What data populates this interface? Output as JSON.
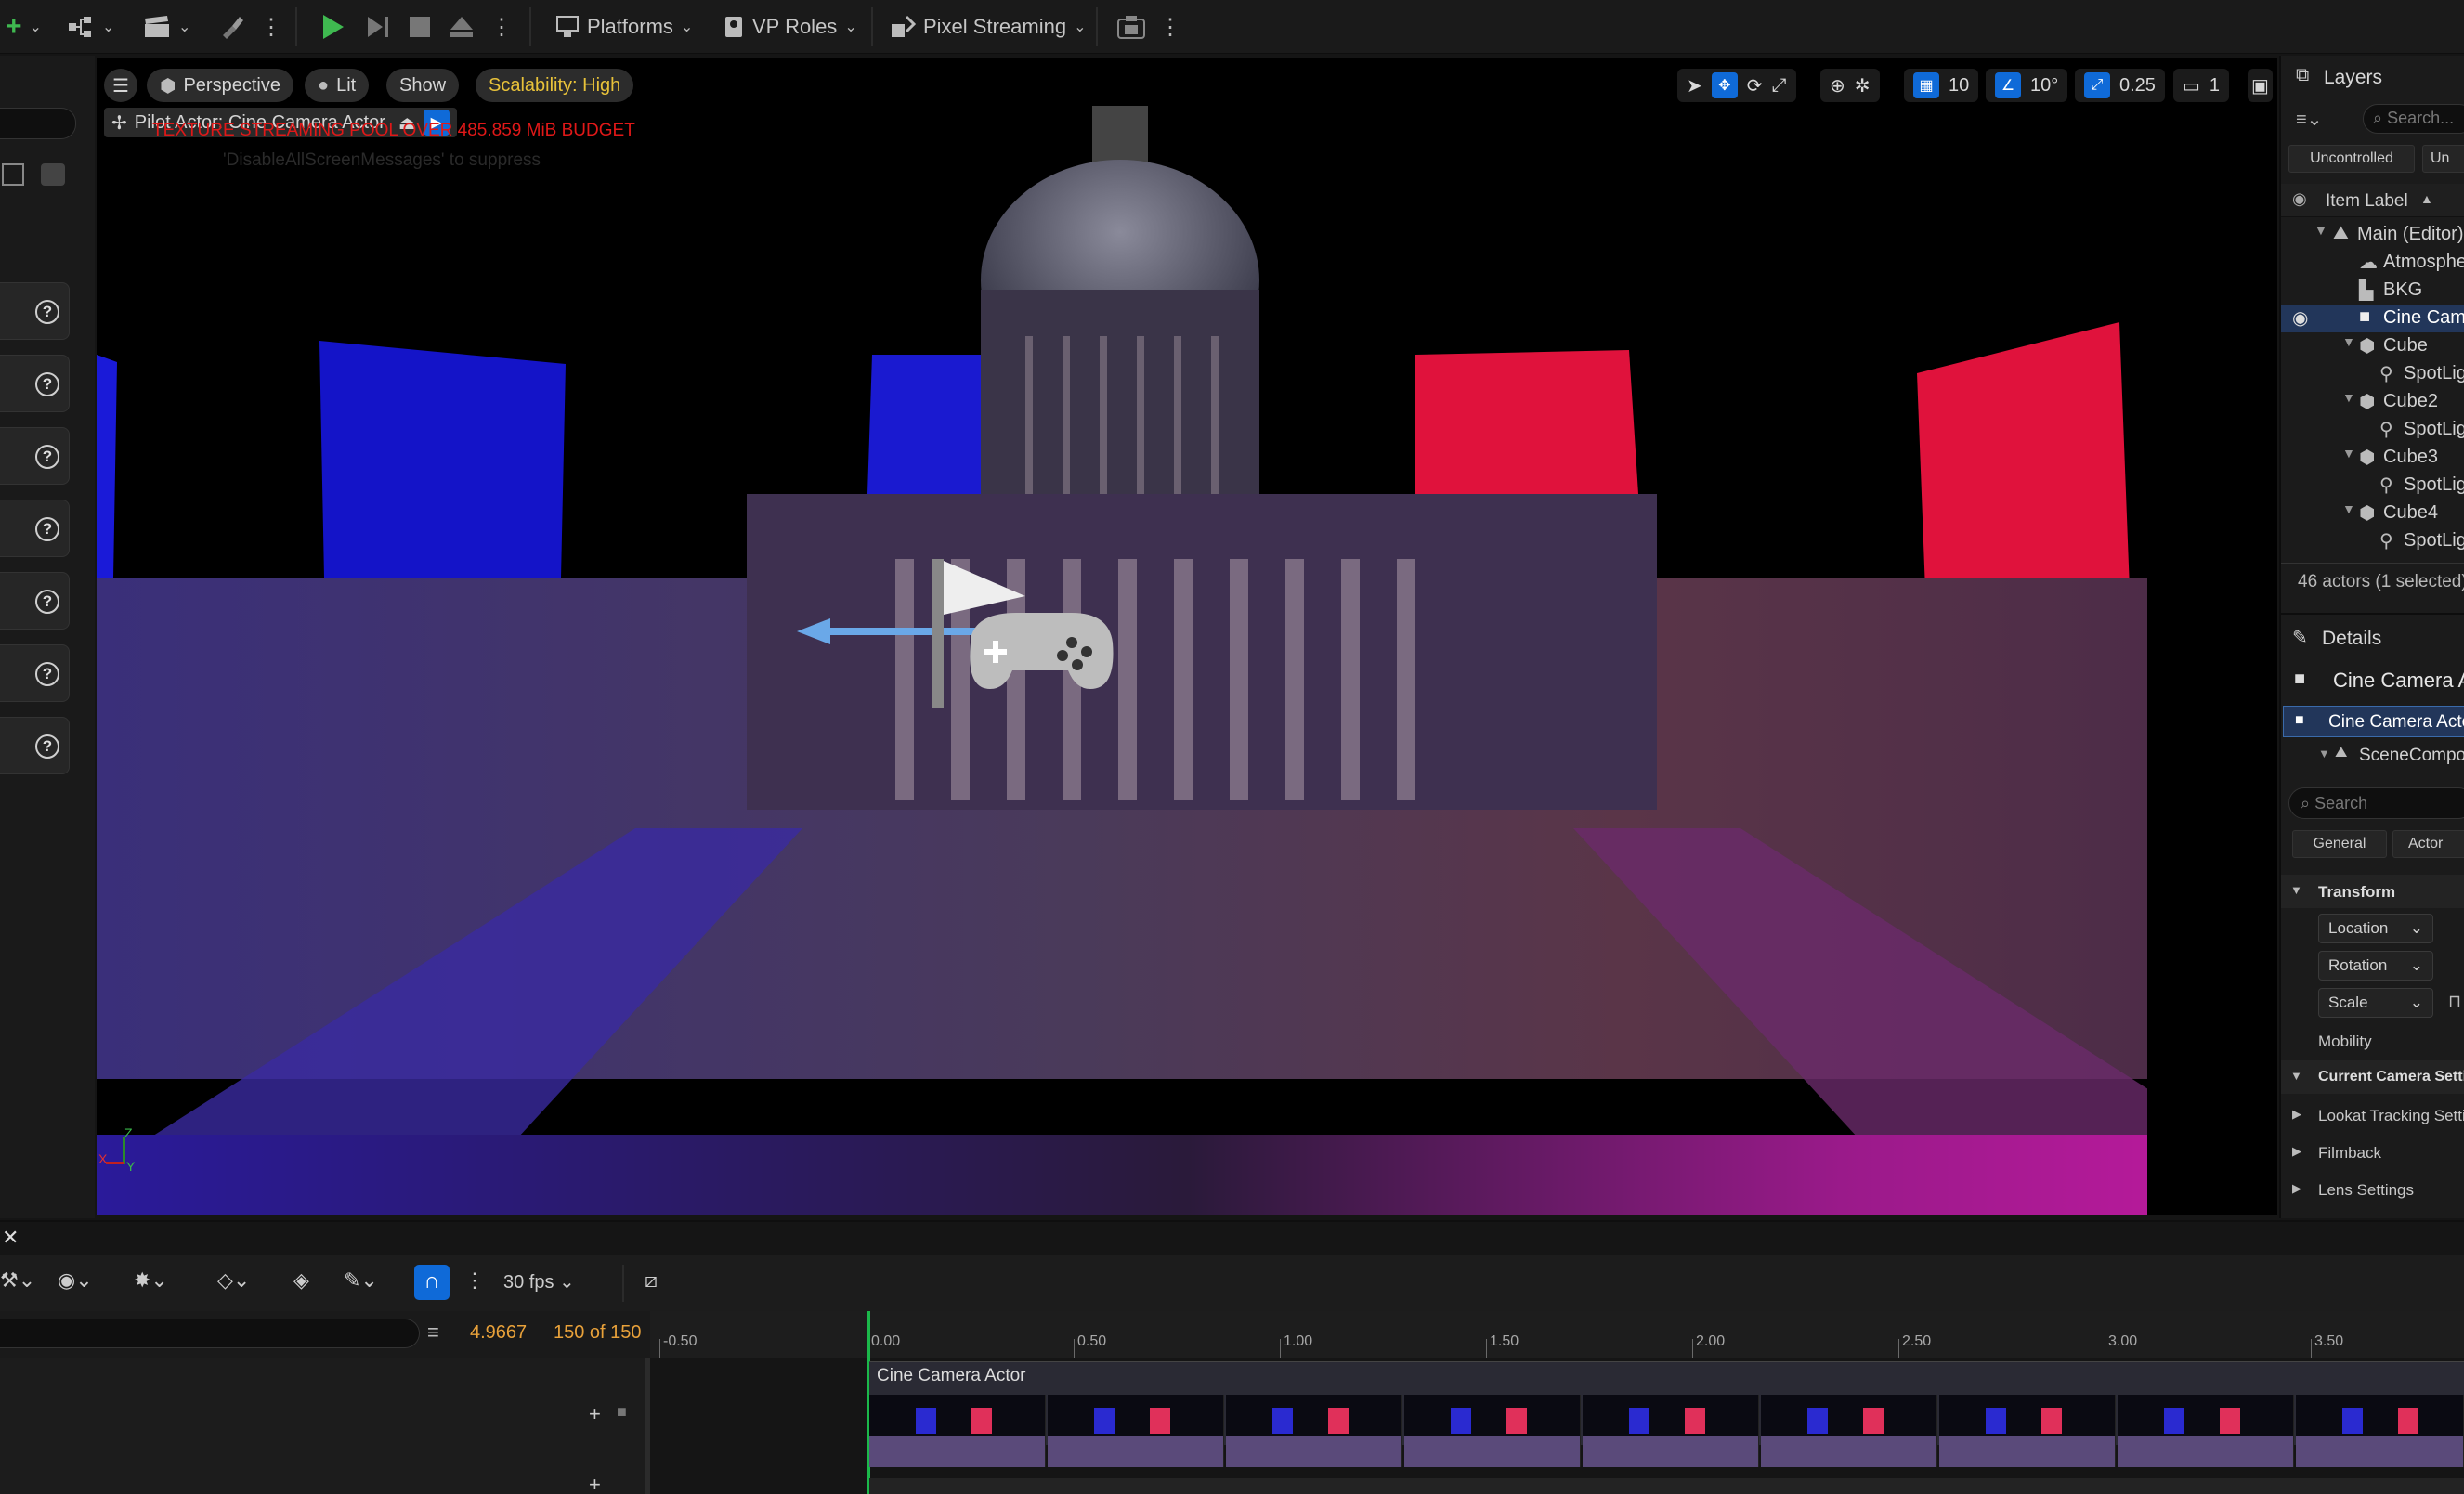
{
  "toolbar": {
    "platforms_label": "Platforms",
    "vp_roles_label": "VP Roles",
    "pixel_streaming_label": "Pixel Streaming"
  },
  "viewport": {
    "perspective_label": "Perspective",
    "lit_label": "Lit",
    "show_label": "Show",
    "scalability_label": "Scalability: High",
    "pilot_actor_label": "Pilot Actor: Cine Camera Actor",
    "warning_text": "TEXTURE STREAMING POOL OVER 485.859 MiB BUDGET",
    "warning_subtext": "'DisableAllScreenMessages' to suppress",
    "grid_snap_value": "10",
    "rotation_snap_value": "10°",
    "scale_snap_value": "0.25",
    "camera_speed_value": "1",
    "axis_x": "X",
    "axis_y": "Y",
    "axis_z": "Z"
  },
  "layers": {
    "title": "Layers",
    "search_placeholder": "Search...",
    "uncontrolled_label": "Uncontrolled",
    "unsaved_label": "Un",
    "column_header": "Item Label",
    "items": [
      {
        "label": "Main (Editor)"
      },
      {
        "label": "Atmosphere"
      },
      {
        "label": "BKG"
      },
      {
        "label": "Cine Camera"
      },
      {
        "label": "Cube"
      },
      {
        "label": "SpotLight"
      },
      {
        "label": "Cube2"
      },
      {
        "label": "SpotLight"
      },
      {
        "label": "Cube3"
      },
      {
        "label": "SpotLight"
      },
      {
        "label": "Cube4"
      },
      {
        "label": "SpotLight"
      }
    ],
    "actor_count": "46 actors (1 selected)"
  },
  "details": {
    "title": "Details",
    "actor_name": "Cine Camera Actor",
    "component_selected": "Cine Camera Actor",
    "component_child": "SceneComponent",
    "search_placeholder": "Search",
    "tab_general": "General",
    "tab_actor": "Actor",
    "section_transform": "Transform",
    "location_label": "Location",
    "rotation_label": "Rotation",
    "scale_label": "Scale",
    "mobility_label": "Mobility",
    "section_camera": "Current Camera Settings",
    "lookat_label": "Lookat Tracking Settings",
    "filmback_label": "Filmback",
    "lens_label": "Lens Settings"
  },
  "sequencer": {
    "fps_label": "30 fps",
    "current_time": "4.9667",
    "frame_counter": "150 of 150",
    "track_name": "Cine Camera Actor",
    "ticks": [
      "-0.50",
      "0.00",
      "0.50",
      "1.00",
      "1.50",
      "2.00",
      "2.50",
      "3.00",
      "3.50"
    ]
  },
  "colors": {
    "accent_blue": "#0f6ad8",
    "scalability_yellow": "#e8c23a",
    "warning_red": "#e01818",
    "time_orange": "#e8a13a",
    "playhead_green": "#1bb84a"
  }
}
